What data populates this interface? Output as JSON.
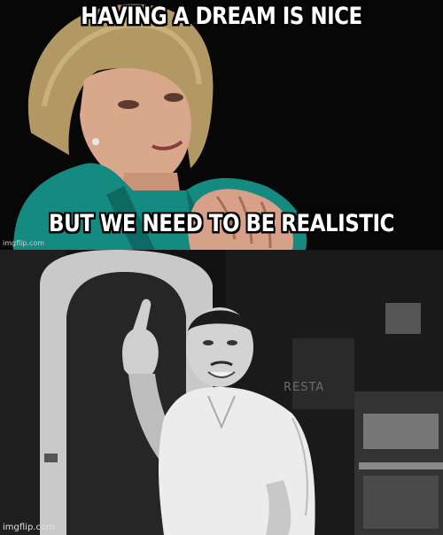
{
  "meme": {
    "top_panel": {
      "caption_top": "HAVING A DREAM IS NICE",
      "caption_bottom": "BUT WE NEED TO BE REALISTIC",
      "watermark": "imgflip.com"
    },
    "bottom_panel": {
      "sign_text": "RESTA",
      "watermark": "imgflip.com"
    }
  }
}
